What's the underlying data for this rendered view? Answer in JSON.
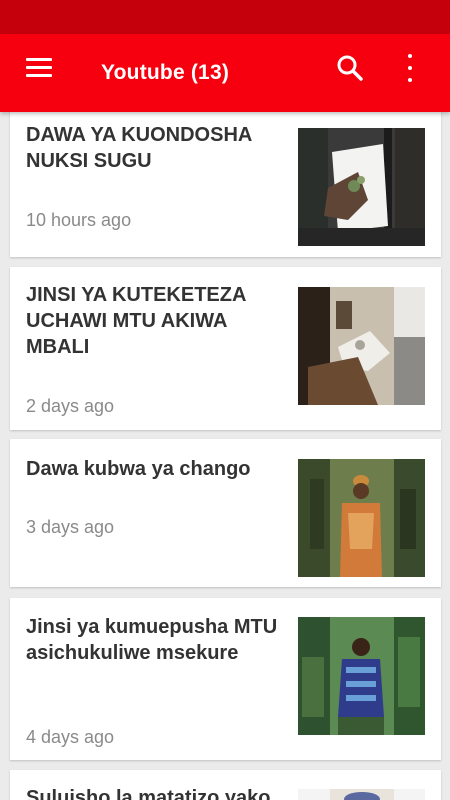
{
  "app_bar": {
    "title": "Youtube (13)",
    "menu_icon": "hamburger-menu-icon",
    "search_icon": "search-icon",
    "more_icon": "more-vertical-icon"
  },
  "colors": {
    "status_bar": "#c5000c",
    "app_bar": "#f6000f",
    "background": "#ebebeb",
    "title_text": "#333333",
    "time_text": "#8a8a8a"
  },
  "videos": [
    {
      "title": "DAWA YA KUONDOSHA NUKSI SUGU",
      "time": "10 hours ago"
    },
    {
      "title": "JINSI YA KUTEKETEZA UCHAWI MTU AKIWA MBALI",
      "time": "2 days ago"
    },
    {
      "title": "Dawa kubwa ya chango",
      "time": "3 days ago"
    },
    {
      "title": "Jinsi ya kumuepusha MTU asichukuliwe msekure",
      "time": "4 days ago"
    },
    {
      "title": "Suluisho la matatizo yako",
      "time": ""
    }
  ]
}
